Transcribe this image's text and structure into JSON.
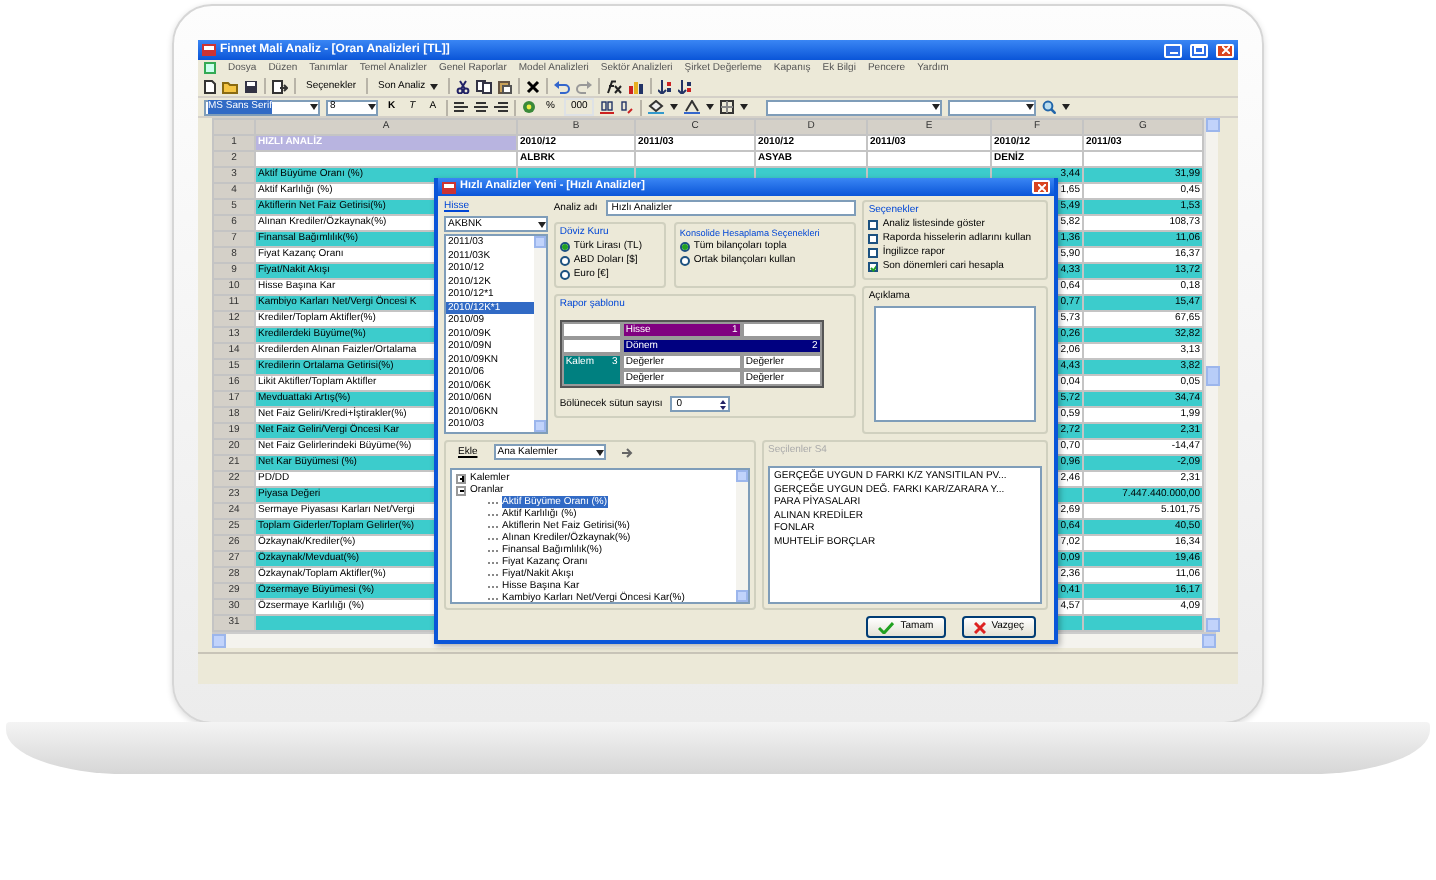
{
  "window": {
    "title": "Finnet Mali Analiz - [Oran Analizleri [TL]]"
  },
  "menu": [
    "Dosya",
    "Düzen",
    "Tanımlar",
    "Temel Analizler",
    "Genel Raporlar",
    "Model Analizleri",
    "Sektör Analizleri",
    "Şirket Değerleme",
    "Kapanış",
    "Ek Bilgi",
    "Pencere",
    "Yardım"
  ],
  "toolbar": {
    "options_button": "Seçenekler",
    "last_analysis_button": "Son Analiz"
  },
  "format_bar": {
    "font": "MS Sans Serif",
    "size": "8",
    "bold": "K",
    "italic": "T",
    "font_size_button": "A",
    "percent": "%",
    "thousands": "000"
  },
  "sheet": {
    "columns": [
      "A",
      "B",
      "C",
      "D",
      "E",
      "F",
      "G"
    ],
    "rows": [
      {
        "number": "1",
        "kind": "header",
        "cells": {
          "A": "HIZLI ANALİZ",
          "B": "2010/12",
          "C": "2011/03",
          "D": "2010/12",
          "E": "2011/03",
          "F": "2010/12",
          "G": "2011/03"
        }
      },
      {
        "number": "2",
        "kind": "plain",
        "cells": {
          "B": "ALBRK",
          "D": "ASYAB",
          "F": "DENİZ"
        }
      },
      {
        "number": "3",
        "kind": "shaded",
        "cells": {
          "A": "Aktif Büyüme Oranı (%)",
          "F": "3,44",
          "G": "31,99"
        }
      },
      {
        "number": "4",
        "kind": "plain",
        "cells": {
          "A": "Aktif Karlılığı (%)",
          "F": "1,65",
          "G": "0,45"
        }
      },
      {
        "number": "5",
        "kind": "shaded",
        "cells": {
          "A": "Aktiflerin Net Faiz Getirisi(%)",
          "F": "5,49",
          "G": "1,53"
        }
      },
      {
        "number": "6",
        "kind": "plain",
        "cells": {
          "A": "Alınan Krediler/Özkaynak(%)",
          "F": "5,82",
          "G": "108,73"
        }
      },
      {
        "number": "7",
        "kind": "shaded",
        "cells": {
          "A": "Finansal Bağımlılık(%)",
          "F": "1,36",
          "G": "11,06"
        }
      },
      {
        "number": "8",
        "kind": "plain",
        "cells": {
          "A": "Fiyat Kazanç Oranı",
          "F": "5,90",
          "G": "16,37"
        }
      },
      {
        "number": "9",
        "kind": "shaded",
        "cells": {
          "A": "Fiyat/Nakit Akışı",
          "F": "4,33",
          "G": "13,72"
        }
      },
      {
        "number": "10",
        "kind": "plain",
        "cells": {
          "A": "Hisse Başına Kar",
          "F": "0,64",
          "G": "0,18"
        }
      },
      {
        "number": "11",
        "kind": "shaded",
        "cells": {
          "A": "Kambiyo Karları Net/Vergi Öncesi K",
          "F": "0,77",
          "G": "15,47"
        }
      },
      {
        "number": "12",
        "kind": "plain",
        "cells": {
          "A": "Krediler/Toplam Aktifler(%)",
          "F": "5,73",
          "G": "67,65"
        }
      },
      {
        "number": "13",
        "kind": "shaded",
        "cells": {
          "A": "Kredilerdeki Büyüme(%)",
          "F": "0,26",
          "G": "32,82"
        }
      },
      {
        "number": "14",
        "kind": "plain",
        "cells": {
          "A": "Kredilerden Alınan Faizler/Ortalama",
          "F": "2,06",
          "G": "3,13"
        }
      },
      {
        "number": "15",
        "kind": "shaded",
        "cells": {
          "A": "Kredilerin Ortalama Getirisi(%)",
          "F": "4,43",
          "G": "3,82"
        }
      },
      {
        "number": "16",
        "kind": "plain",
        "cells": {
          "A": "Likit Aktifler/Toplam Aktifler",
          "F": "0,04",
          "G": "0,05"
        }
      },
      {
        "number": "17",
        "kind": "shaded",
        "cells": {
          "A": "Mevduattaki Artış(%)",
          "F": "5,72",
          "G": "34,74"
        }
      },
      {
        "number": "18",
        "kind": "plain",
        "cells": {
          "A": "Net Faiz Geliri/Kredi+İştirakler(%)",
          "F": "0,59",
          "G": "1,99"
        }
      },
      {
        "number": "19",
        "kind": "shaded",
        "cells": {
          "A": "Net Faiz Geliri/Vergi Öncesi Kar",
          "F": "2,72",
          "G": "2,31"
        }
      },
      {
        "number": "20",
        "kind": "plain",
        "cells": {
          "A": "Net Faiz Gelirlerindeki Büyüme(%)",
          "F": "0,70",
          "G": "-14,47"
        }
      },
      {
        "number": "21",
        "kind": "shaded",
        "cells": {
          "A": "Net Kar Büyümesi (%)",
          "F": "0,96",
          "G": "-2,09"
        }
      },
      {
        "number": "22",
        "kind": "plain",
        "cells": {
          "A": "PD/DD",
          "F": "2,46",
          "G": "2,31"
        }
      },
      {
        "number": "23",
        "kind": "shaded",
        "cells": {
          "A": "Piyasa Değeri",
          "G": "7.447.440.000,00"
        }
      },
      {
        "number": "24",
        "kind": "plain",
        "cells": {
          "A": "Sermaye Piyasası Karları Net/Vergi",
          "F": "2,69",
          "G": "5.101,75"
        }
      },
      {
        "number": "25",
        "kind": "shaded",
        "cells": {
          "A": "Toplam Giderler/Toplam Gelirler(%)",
          "F": "0,64",
          "G": "40,50"
        }
      },
      {
        "number": "26",
        "kind": "plain",
        "cells": {
          "A": "Özkaynak/Krediler(%)",
          "F": "7,02",
          "G": "16,34"
        }
      },
      {
        "number": "27",
        "kind": "shaded",
        "cells": {
          "A": "Özkaynak/Mevduat(%)",
          "F": "0,09",
          "G": "19,46"
        }
      },
      {
        "number": "28",
        "kind": "plain",
        "cells": {
          "A": "Özkaynak/Toplam Aktifler(%)",
          "F": "2,36",
          "G": "11,06"
        }
      },
      {
        "number": "29",
        "kind": "shaded",
        "cells": {
          "A": "Özsermaye Büyümesi (%)",
          "F": "0,41",
          "G": "16,17"
        }
      },
      {
        "number": "30",
        "kind": "plain",
        "cells": {
          "A": "Özsermaye Karlılığı (%)",
          "F": "4,57",
          "G": "4,09"
        }
      },
      {
        "number": "31",
        "kind": "shaded",
        "cells": {}
      }
    ]
  },
  "dialog": {
    "title": "Hızlı Analizler Yeni - [Hızlı Analizler]",
    "stock": {
      "label": "Hisse",
      "value": "AKBNK",
      "periods": [
        {
          "label": "2011/03",
          "selected": false
        },
        {
          "label": "2011/03K",
          "selected": false
        },
        {
          "label": "2010/12",
          "selected": false
        },
        {
          "label": "2010/12K",
          "selected": false
        },
        {
          "label": "2010/12*1",
          "selected": false
        },
        {
          "label": "2010/12K*1",
          "selected": true
        },
        {
          "label": "2010/09",
          "selected": false
        },
        {
          "label": "2010/09K",
          "selected": false
        },
        {
          "label": "2010/09N",
          "selected": false
        },
        {
          "label": "2010/09KN",
          "selected": false
        },
        {
          "label": "2010/06",
          "selected": false
        },
        {
          "label": "2010/06K",
          "selected": false
        },
        {
          "label": "2010/06N",
          "selected": false
        },
        {
          "label": "2010/06KN",
          "selected": false
        },
        {
          "label": "2010/03",
          "selected": false
        }
      ]
    },
    "analysis_name": {
      "label": "Analiz adı",
      "value": "Hızlı Analizler"
    },
    "currency": {
      "label": "Döviz Kuru",
      "options": [
        {
          "label": "Türk Lirası (TL)",
          "selected": true
        },
        {
          "label": "ABD Doları [$]",
          "selected": false
        },
        {
          "label": "Euro [€]",
          "selected": false
        }
      ]
    },
    "consolidation": {
      "label": "Konsolide Hesaplama Seçenekleri",
      "options": [
        {
          "label": "Tüm bilançoları topla",
          "selected": true
        },
        {
          "label": "Ortak bilançoları kullan",
          "selected": false
        }
      ]
    },
    "options": {
      "label": "Seçenekler",
      "items": [
        {
          "label": "Analiz listesinde göster",
          "checked": false
        },
        {
          "label": "Raporda hisselerin adlarını kullan",
          "checked": false
        },
        {
          "label": "İngilizce rapor",
          "checked": false
        },
        {
          "label": "Son dönemleri cari hesapla",
          "checked": true
        }
      ]
    },
    "template": {
      "label": "Rapor şablonu",
      "fields": [
        {
          "label": "Hisse",
          "number": "1",
          "color": "#800080"
        },
        {
          "label": "Dönem",
          "number": "2",
          "color": "#000080"
        },
        {
          "label": "Kalem",
          "number": "3",
          "color": "#008080"
        }
      ],
      "values": [
        "Değerler",
        "Değerler",
        "Değerler",
        "Değerler"
      ]
    },
    "split_columns": {
      "label": "Bölünecek sütun sayısı",
      "value": "0"
    },
    "description": {
      "label": "Açıklama"
    },
    "add": {
      "label": "Ekle",
      "value": "Ana Kalemler"
    },
    "tree": [
      {
        "label": "Kalemler",
        "expanded": false
      },
      {
        "label": "Oranlar",
        "expanded": true,
        "children": [
          {
            "label": "Aktif Büyüme Oranı (%)",
            "selected": true
          },
          {
            "label": "Aktif Karlılığı (%)",
            "selected": false
          },
          {
            "label": "Aktiflerin Net Faiz Getirisi(%)",
            "selected": false
          },
          {
            "label": "Alınan Krediler/Özkaynak(%)",
            "selected": false
          },
          {
            "label": "Finansal Bağımlılık(%)",
            "selected": false
          },
          {
            "label": "Fiyat Kazanç Oranı",
            "selected": false
          },
          {
            "label": "Fiyat/Nakit Akışı",
            "selected": false
          },
          {
            "label": "Hisse Başına Kar",
            "selected": false
          },
          {
            "label": "Kambiyo Karları Net/Vergi Öncesi Kar(%)",
            "selected": false
          }
        ]
      }
    ],
    "selected_list": {
      "label": "Seçilenler S4",
      "items": [
        "GERÇEĞE UYGUN D FARKI K/Z YANSITILAN PV...",
        "GERÇEĞE UYGUN DEĞ. FARKI KAR/ZARARA Y...",
        "PARA PİYASALARI",
        "ALINAN KREDİLER",
        "FONLAR",
        "MUHTELİF BORÇLAR"
      ]
    },
    "buttons": [
      {
        "kind": "ok",
        "label": "Tamam"
      },
      {
        "kind": "cancel",
        "label": "Vazgeç"
      }
    ]
  }
}
